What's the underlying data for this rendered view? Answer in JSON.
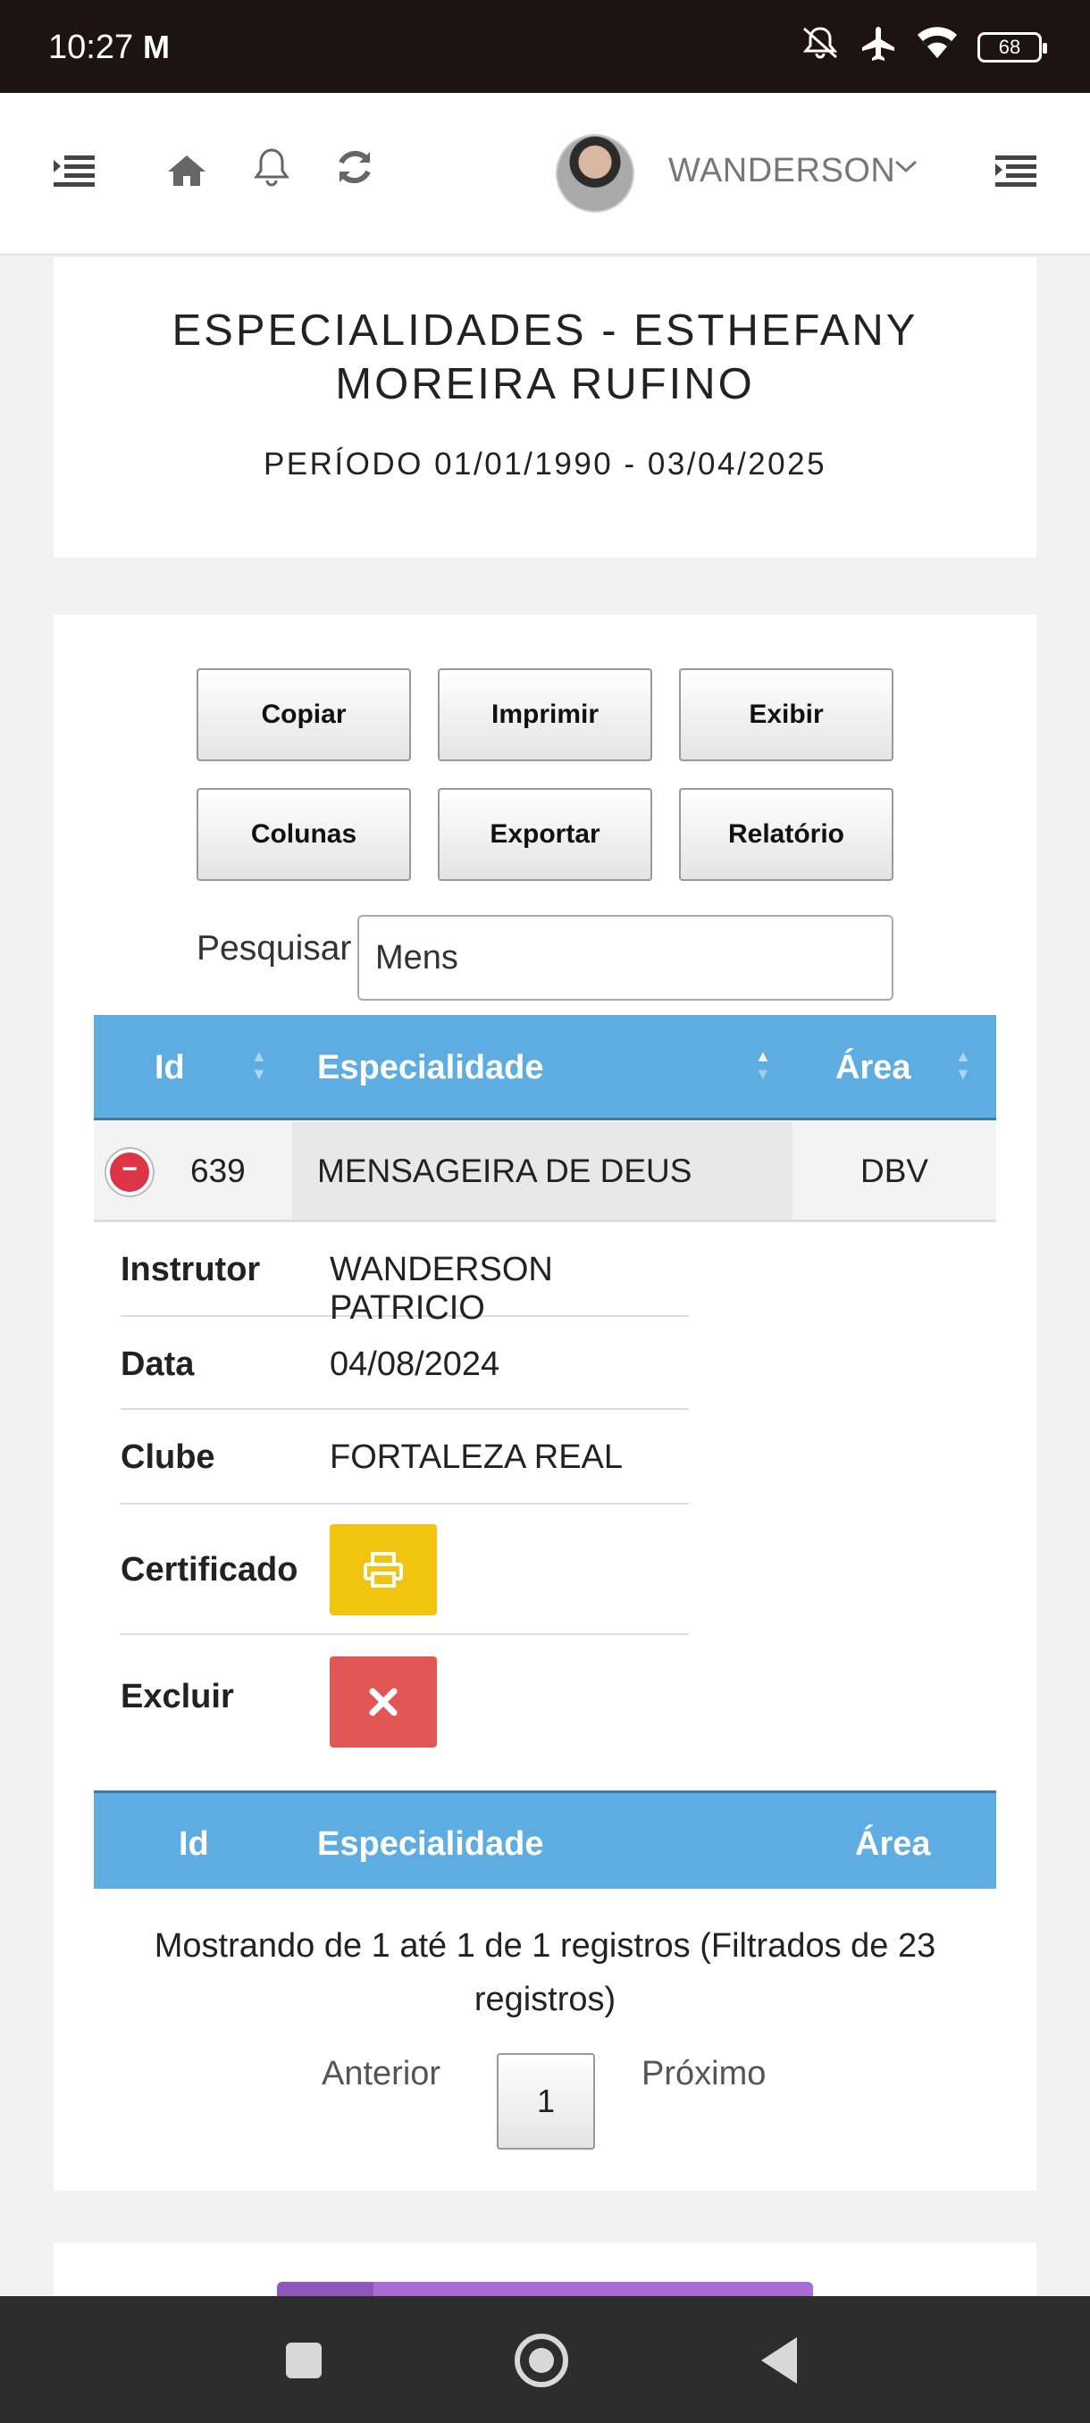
{
  "status_bar": {
    "time": "10:27",
    "carrier_icon": "M",
    "battery": "68",
    "icons": [
      "mute-icon",
      "airplane-icon",
      "wifi-icon",
      "battery-icon"
    ]
  },
  "topnav": {
    "username": "WANDERSON",
    "icons": [
      "menu-left-icon",
      "home-icon",
      "bell-icon",
      "refresh-icon",
      "avatar",
      "chevron-down-icon",
      "menu-right-icon"
    ]
  },
  "header": {
    "title": "ESPECIALIDADES - ESTHEFANY MOREIRA RUFINO",
    "period": "PERÍODO 01/01/1990 - 03/04/2025"
  },
  "toolbar": {
    "copy": "Copiar",
    "print": "Imprimir",
    "show": "Exibir",
    "columns": "Colunas",
    "export": "Exportar",
    "report": "Relatório"
  },
  "search": {
    "label": "Pesquisar",
    "value": "Mens"
  },
  "table": {
    "columns": [
      "Id",
      "Especialidade",
      "Área"
    ],
    "row": {
      "id": "639",
      "especialidade": "MENSAGEIRA DE DEUS",
      "area": "DBV"
    },
    "details": {
      "instrutor_label": "Instrutor",
      "instrutor": "WANDERSON PATRICIO",
      "data_label": "Data",
      "data": "04/08/2024",
      "clube_label": "Clube",
      "clube": "FORTALEZA REAL",
      "certificado_label": "Certificado",
      "excluir_label": "Excluir"
    }
  },
  "pagination": {
    "info": "Mostrando de 1 até 1 de 1 registros (Filtrados de 23 registros)",
    "previous": "Anterior",
    "page": "1",
    "next": "Próximo"
  },
  "colors": {
    "table_header": "#5dade2",
    "print_button": "#f1c40f",
    "delete_button": "#e25656",
    "remove_row": "#dc3545"
  }
}
